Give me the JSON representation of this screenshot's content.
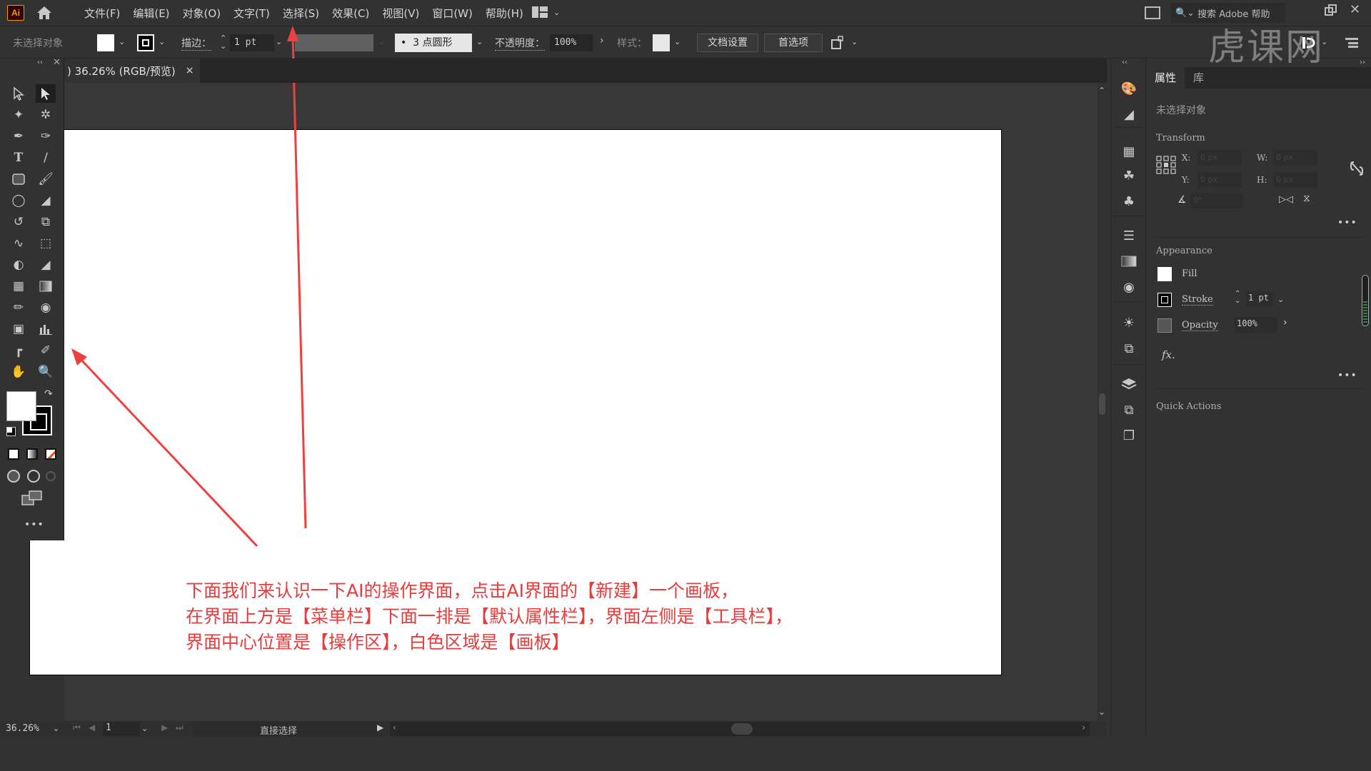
{
  "menubar": {
    "logo": "Ai",
    "items": [
      "文件(F)",
      "编辑(E)",
      "对象(O)",
      "文字(T)",
      "选择(S)",
      "效果(C)",
      "视图(V)",
      "窗口(W)",
      "帮助(H)"
    ],
    "search_placeholder": "搜索 Adobe 帮助"
  },
  "controlbar": {
    "selection_status": "未选择对象",
    "stroke_label": "描边：",
    "stroke_weight": "1 pt",
    "brush_label": "3 点圆形",
    "opacity_label": "不透明度：",
    "opacity_value": "100%",
    "style_label": "样式：",
    "doc_setup_button": "文档设置",
    "preferences_button": "首选项"
  },
  "document_tab": {
    "title": ") 36.26% (RGB/预览)",
    "close": "×"
  },
  "statusbar": {
    "zoom": "36.26%",
    "artboard_number": "1",
    "current_tool": "直接选择"
  },
  "annotation": {
    "lines": [
      "下面我们来认识一下AI的操作界面，点击AI界面的【新建】一个画板，",
      "在界面上方是【菜单栏】下面一排是【默认属性栏】，界面左侧是【工具栏】，",
      "界面中心位置是【操作区】，白色区域是【画板】"
    ],
    "color": "#e63c3c"
  },
  "panel": {
    "tabs": [
      "属性",
      "库"
    ],
    "selection_status": "未选择对象",
    "transform": {
      "title": "Transform",
      "x_label": "X:",
      "x_value": "0 px",
      "y_label": "Y:",
      "y_value": "0 px",
      "w_label": "W:",
      "w_value": "0 px",
      "h_label": "H:",
      "h_value": "0 px",
      "angle_value": "0°"
    },
    "appearance": {
      "title": "Appearance",
      "fill_label": "Fill",
      "stroke_label": "Stroke",
      "stroke_value": "1 pt",
      "opacity_label": "Opacity",
      "opacity_value": "100%",
      "fx_label": "fx."
    },
    "quick_actions_title": "Quick Actions"
  },
  "watermark": "虎课网",
  "icons": {
    "more": "•••"
  }
}
